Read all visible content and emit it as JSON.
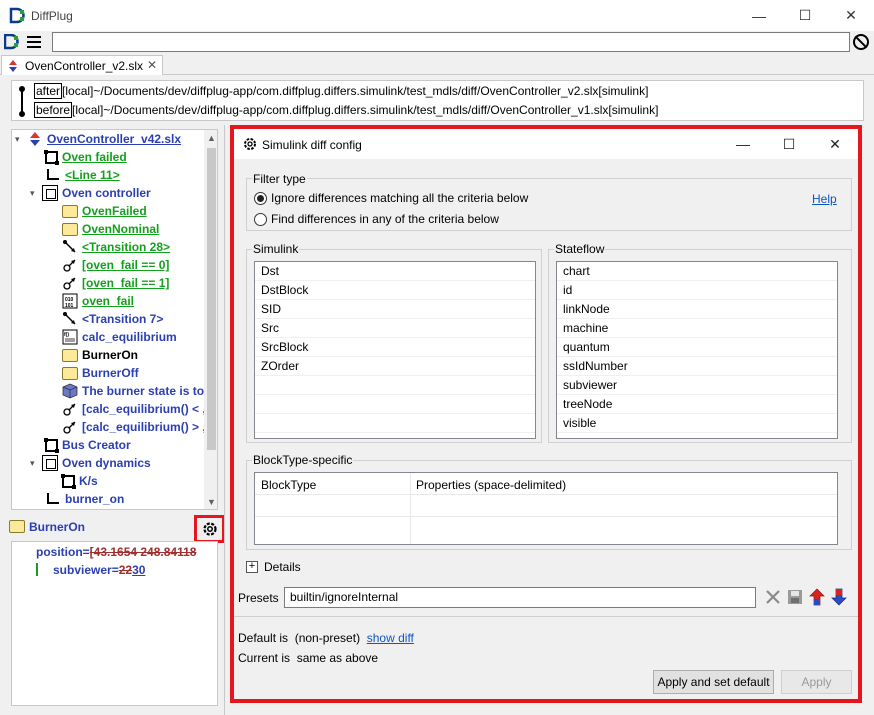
{
  "app": {
    "title": "DiffPlug"
  },
  "window": {
    "minimize": "—",
    "maximize": "☐",
    "close": "✕"
  },
  "tab": {
    "label": "OvenController_v2.slx",
    "close": "✕"
  },
  "paths": {
    "after_tag": "after",
    "after_path": "[local]~/Documents/dev/diffplug-app/com.diffplug.differs.simulink/test_mdls/diff/OvenController_v2.slx[simulink]",
    "before_tag": "before",
    "before_path": "[local]~/Documents/dev/diffplug-app/com.diffplug.differs.simulink/test_mdls/diff/OvenController_v1.slx[simulink]"
  },
  "tree": {
    "root": "OvenController_v42.slx",
    "items": [
      {
        "label": "Oven failed"
      },
      {
        "label": "<Line 11>"
      },
      {
        "label": "Oven controller"
      },
      {
        "label": "OvenFailed"
      },
      {
        "label": "OvenNominal"
      },
      {
        "label": "<Transition 28>"
      },
      {
        "label": "[oven_fail == 0]"
      },
      {
        "label": "[oven_fail == 1]"
      },
      {
        "label": "oven_fail"
      },
      {
        "label": "<Transition 7>"
      },
      {
        "label": "calc_equilibrium"
      },
      {
        "label": "BurnerOn"
      },
      {
        "label": "BurnerOff"
      },
      {
        "label": "The burner state is to"
      },
      {
        "label": "[calc_equilibrium() < ,"
      },
      {
        "label": "[calc_equilibrium() > ,"
      },
      {
        "label": "Bus Creator"
      },
      {
        "label": "Oven dynamics"
      },
      {
        "label": "K/s"
      },
      {
        "label": "burner_on"
      }
    ]
  },
  "props": {
    "header": "BurnerOn",
    "rows": [
      {
        "key": "position=",
        "value": "[43.1654 248.84118"
      },
      {
        "key": "subviewer=",
        "old": "22",
        "new": "30"
      }
    ]
  },
  "dialog": {
    "title": "Simulink diff config",
    "filter_type": {
      "label": "Filter type",
      "option_ignore": "Ignore differences matching all the criteria below",
      "option_find": "Find differences in any of the criteria below",
      "help": "Help"
    },
    "simulink": {
      "label": "Simulink",
      "items": [
        "Dst",
        "DstBlock",
        "SID",
        "Src",
        "SrcBlock",
        "ZOrder"
      ]
    },
    "stateflow": {
      "label": "Stateflow",
      "items": [
        "chart",
        "id",
        "linkNode",
        "machine",
        "quantum",
        "ssIdNumber",
        "subviewer",
        "treeNode",
        "visible"
      ]
    },
    "blocktype": {
      "label": "BlockType-specific",
      "col1": "BlockType",
      "col2": "Properties (space-delimited)"
    },
    "details": "Details",
    "presets_label": "Presets",
    "presets_value": "builtin/ignoreInternal",
    "default_is_label": "Default is",
    "default_is_value": "(non-preset)",
    "show_diff": "show diff",
    "current_is_label": "Current is",
    "current_is_value": "same as above",
    "btn_apply_default": "Apply and set default",
    "btn_apply": "Apply"
  },
  "colors": {
    "highlight": "#e5161e",
    "added": "#14a01e",
    "changed": "#2b3fb0"
  }
}
